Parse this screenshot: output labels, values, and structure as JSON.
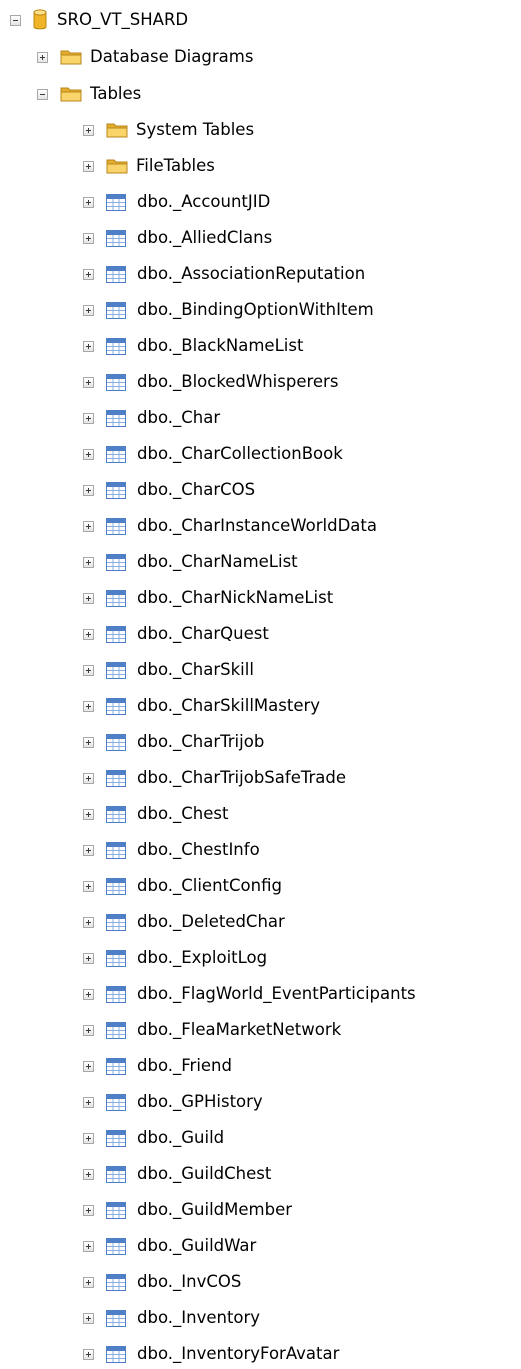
{
  "tree": {
    "database": {
      "label": "SRO_VT_SHARD",
      "expanded": true,
      "icon": "database-icon"
    },
    "database_diagrams": {
      "label": "Database Diagrams",
      "expanded": false,
      "icon": "folder-icon"
    },
    "tables": {
      "label": "Tables",
      "expanded": true,
      "icon": "folder-icon",
      "system_tables": {
        "label": "System Tables",
        "expanded": false,
        "icon": "folder-icon"
      },
      "file_tables": {
        "label": "FileTables",
        "expanded": false,
        "icon": "folder-icon"
      },
      "items": [
        "dbo._AccountJID",
        "dbo._AlliedClans",
        "dbo._AssociationReputation",
        "dbo._BindingOptionWithItem",
        "dbo._BlackNameList",
        "dbo._BlockedWhisperers",
        "dbo._Char",
        "dbo._CharCollectionBook",
        "dbo._CharCOS",
        "dbo._CharInstanceWorldData",
        "dbo._CharNameList",
        "dbo._CharNickNameList",
        "dbo._CharQuest",
        "dbo._CharSkill",
        "dbo._CharSkillMastery",
        "dbo._CharTrijob",
        "dbo._CharTrijobSafeTrade",
        "dbo._Chest",
        "dbo._ChestInfo",
        "dbo._ClientConfig",
        "dbo._DeletedChar",
        "dbo._ExploitLog",
        "dbo._FlagWorld_EventParticipants",
        "dbo._FleaMarketNetwork",
        "dbo._Friend",
        "dbo._GPHistory",
        "dbo._Guild",
        "dbo._GuildChest",
        "dbo._GuildMember",
        "dbo._GuildWar",
        "dbo._InvCOS",
        "dbo._Inventory",
        "dbo._InventoryForAvatar"
      ]
    }
  },
  "colors": {
    "folder": "#f2c94c",
    "database": "#f0b429",
    "table": "#4f7fc6"
  }
}
